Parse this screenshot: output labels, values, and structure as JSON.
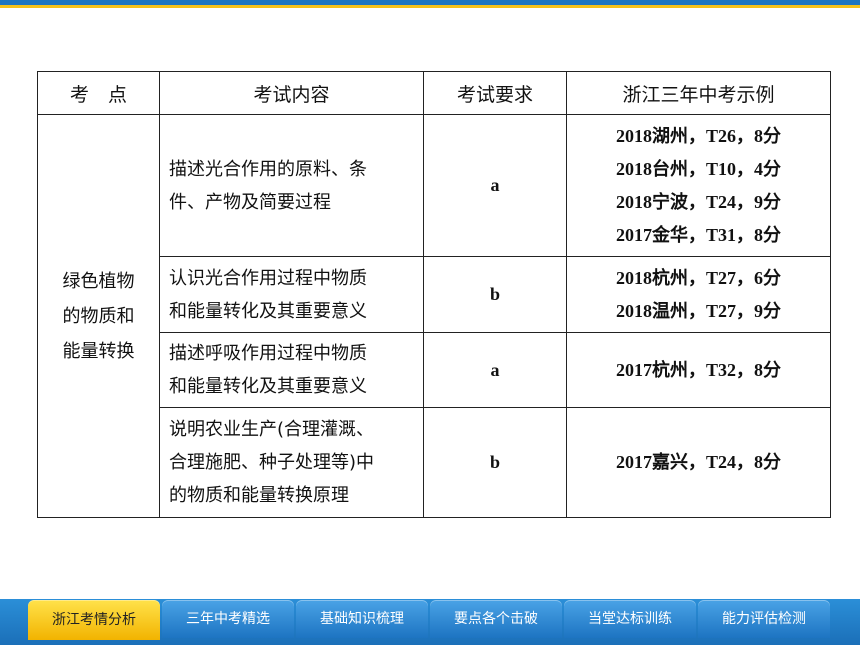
{
  "table": {
    "headers": [
      "考　点",
      "考试内容",
      "考试要求",
      "浙江三年中考示例"
    ],
    "category": [
      "绿色植物",
      "的物质和",
      "能量转换"
    ],
    "rows": [
      {
        "content": [
          "描述光合作用的原料、条",
          "件、产物及简要过程"
        ],
        "requirement": "a",
        "examples": [
          "2018湖州，T26，8分",
          "2018台州，T10，4分",
          "2018宁波，T24，9分",
          "2017金华，T31，8分"
        ]
      },
      {
        "content": [
          "认识光合作用过程中物质",
          "和能量转化及其重要意义"
        ],
        "requirement": "b",
        "examples": [
          "2018杭州，T27，6分",
          "2018温州，T27，9分"
        ]
      },
      {
        "content": [
          "描述呼吸作用过程中物质",
          "和能量转化及其重要意义"
        ],
        "requirement": "a",
        "examples": [
          "2017杭州，T32，8分"
        ]
      },
      {
        "content": [
          "说明农业生产(合理灌溉、",
          "合理施肥、种子处理等)中",
          "的物质和能量转换原理"
        ],
        "requirement": "b",
        "examples": [
          "2017嘉兴，T24，8分"
        ]
      }
    ]
  },
  "nav": {
    "tabs": [
      "浙江考情分析",
      "三年中考精选",
      "基础知识梳理",
      "要点各个击破",
      "当堂达标训练",
      "能力评估检测"
    ],
    "active_index": 0
  },
  "colors": {
    "accent_blue": "#1f76c2",
    "accent_yellow": "#f6c21c"
  }
}
